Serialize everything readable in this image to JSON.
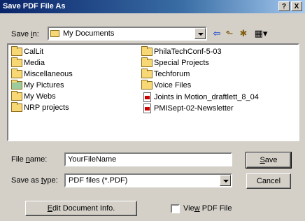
{
  "window": {
    "title": "Save PDF File As",
    "help": "?",
    "close": "X"
  },
  "savein": {
    "label_pre": "Save ",
    "label_key": "i",
    "label_post": "n:",
    "value": "My Documents"
  },
  "toolbar": {
    "back": "⇦",
    "up": "⬑",
    "new_folder": "✱",
    "views": "▦▾"
  },
  "files_col1": [
    "CalLit",
    "Media",
    "Miscellaneous",
    "My Pictures",
    "My Webs",
    "NRP projects"
  ],
  "files_col2": [
    "PhilaTechConf-5-03",
    "Special Projects",
    "Techforum",
    "Voice Files",
    "Joints in Motion_draftlett_8_04",
    "PMISept-02-Newsletter"
  ],
  "filename": {
    "label_pre": "File ",
    "label_key": "n",
    "label_post": "ame:",
    "value": "YourFileName"
  },
  "savetype": {
    "label_pre": "Save as ",
    "label_key": "t",
    "label_post": "ype:",
    "value": "PDF files (*.PDF)"
  },
  "buttons": {
    "save_key": "S",
    "save_rest": "ave",
    "cancel": "Cancel",
    "edit_key": "E",
    "edit_rest": "dit Document Info."
  },
  "viewpdf": {
    "pre": "Vie",
    "key": "w",
    "post": " PDF File"
  }
}
